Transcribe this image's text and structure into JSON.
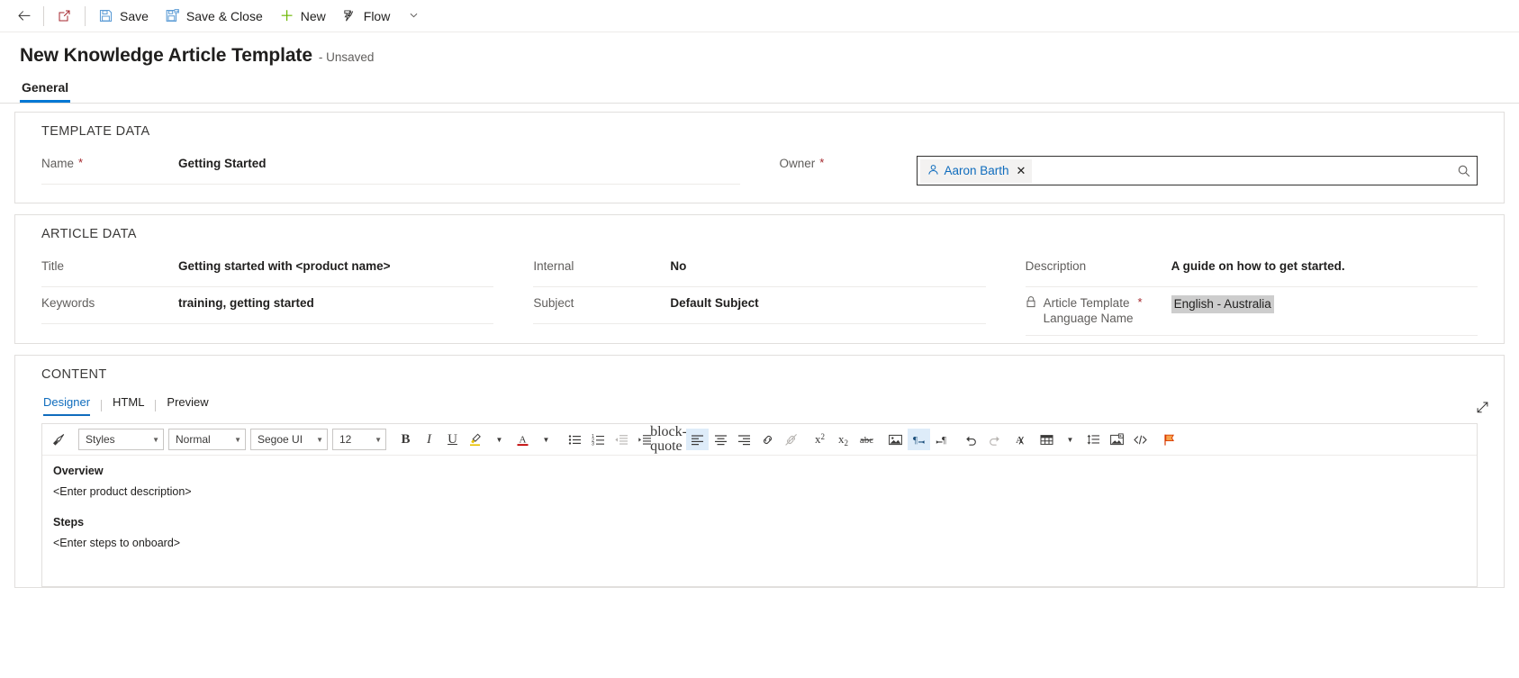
{
  "commandbar": {
    "back_tooltip": "Back",
    "popout_tooltip": "Open in new window",
    "save_label": "Save",
    "save_close_label": "Save & Close",
    "new_label": "New",
    "flow_label": "Flow"
  },
  "header": {
    "title": "New Knowledge Article Template",
    "state": "- Unsaved"
  },
  "tabs": [
    {
      "label": "General",
      "selected": true
    }
  ],
  "template_data": {
    "section_title": "TEMPLATE DATA",
    "name_label": "Name",
    "name_value": "Getting Started",
    "name_required": "*",
    "owner_label": "Owner",
    "owner_required": "*",
    "owner_value": "Aaron Barth",
    "owner_remove": "✕"
  },
  "article_data": {
    "section_title": "ARTICLE DATA",
    "title_label": "Title",
    "title_value": "Getting started with <product name>",
    "keywords_label": "Keywords",
    "keywords_value": "training, getting started",
    "internal_label": "Internal",
    "internal_value": "No",
    "subject_label": "Subject",
    "subject_value": "Default Subject",
    "description_label": "Description",
    "description_value": "A guide on how to get started.",
    "language_label_line1": "Article Template",
    "language_label_line2": "Language Name",
    "language_required": "*",
    "language_value": "English - Australia"
  },
  "content": {
    "section_title": "CONTENT",
    "editor_tabs": [
      {
        "label": "Designer",
        "selected": true
      },
      {
        "label": "HTML",
        "selected": false
      },
      {
        "label": "Preview",
        "selected": false
      }
    ],
    "toolbar": {
      "format_painter": "format-painter",
      "styles": "Styles",
      "paragraph": "Normal",
      "font": "Segoe UI",
      "size": "12",
      "bold": "B",
      "italic": "I",
      "underline": "U",
      "highlight": "highlight",
      "font_color": "font-color",
      "bullets": "bulleted-list",
      "numbering": "numbered-list",
      "outdent": "decrease-indent",
      "indent": "increase-indent",
      "quote": "block-quote",
      "align_left": "align-left",
      "align_center": "align-center",
      "align_right": "align-right",
      "link": "insert-link",
      "unlink": "remove-link",
      "superscript": "superscript",
      "subscript": "subscript",
      "strikethrough": "strikethrough",
      "image": "insert-image",
      "rtl": "right-to-left",
      "ltr": "left-to-right",
      "undo": "undo",
      "redo": "redo",
      "clear_format": "clear-formatting",
      "table": "insert-table",
      "line_spacing": "line-spacing",
      "insert_media": "insert-media",
      "source_code": "source-code",
      "flag": "flag"
    },
    "body": {
      "overview_heading": "Overview",
      "overview_text": "<Enter product description>",
      "steps_heading": "Steps",
      "steps_text": "<Enter steps to onboard>"
    },
    "expand_tooltip": "Expand"
  },
  "colors": {
    "accent": "#0078d4",
    "link": "#0f6cbd",
    "required": "#a4262c",
    "new_icon": "#6bb700",
    "save_icon": "#5b9bd5",
    "selection": "#cdcdcd"
  }
}
